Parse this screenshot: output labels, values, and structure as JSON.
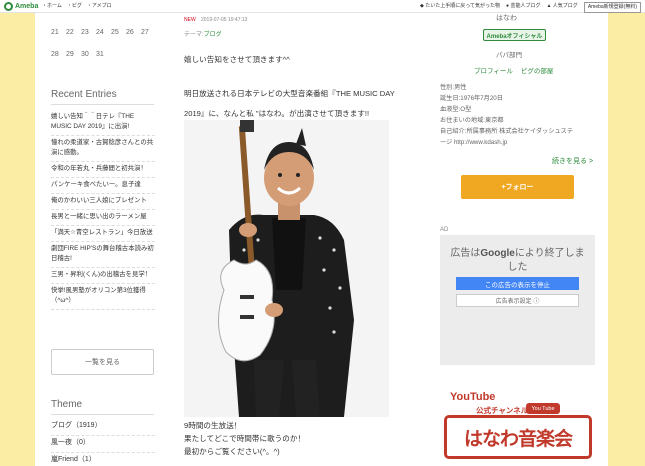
{
  "topbar": {
    "logo_text": "Ameba",
    "nav": [
      "・ホーム",
      "・ピグ",
      "・アメブロ"
    ],
    "notice": "たいた上手順に戻って気がった物",
    "links": [
      "芸能人ブログ",
      "人気ブログ"
    ],
    "register": "Ameba新規登録(無料)"
  },
  "calendar": {
    "rows": [
      [
        "21",
        "22",
        "23",
        "24",
        "25",
        "26",
        "27"
      ],
      [
        "28",
        "29",
        "30",
        "31"
      ]
    ]
  },
  "sidebar": {
    "recent_title": "Recent Entries",
    "entries": [
      "嬉しい告知＾＾日テレ『THE MUSIC DAY 2019』に出演!",
      "憧れの柔道家・古賀稔彦さんとの共演に感動。",
      "令和の年若丸・兵藤間と初共演！",
      "パンケーキ食べたいー。息子達",
      "俺のかわいい三人娘にプレゼント",
      "長男と一緒に思い出のラーメン屋",
      "「満天☆青空レストラン」今日放送",
      "劇団FIRE HIP'Sの舞台稽古本読み初日稽古!",
      "三男・昇利(くん)の出稽古を見学！",
      "快挙!風男塾がオリコン第3位獲得（^ω^）"
    ],
    "more_label": "一覧を見る",
    "theme_title": "Theme",
    "themes": [
      "ブログ（1919）",
      "風一夜（0）",
      "嵐Friend（1）"
    ]
  },
  "post": {
    "new_label": "NEW",
    "date": "2019-07-05 19:47:13",
    "theme_prefix": "テーマ:",
    "theme": "ブログ",
    "lines_top": [
      "嬉しい告知をさせて頂きます^^",
      "明日放送される日本テレビの大型音楽番組『THE MUSIC DAY",
      "2019』に、なんと私  \"はなわ。が出演させて頂きます!!"
    ],
    "lines_bottom": [
      "9時間の生放送！",
      "果たしてどこで時間帯に歌うのか！",
      "最初からご覧ください(^。^)"
    ]
  },
  "profile": {
    "name": "はなわ",
    "official_badge": "Amebaオフィシャル",
    "sub": "パパ部門",
    "links": [
      "プロフィール",
      "ピグの部屋"
    ],
    "details": [
      "性別:男性",
      "誕生日:1976年7月20日",
      "血液型:O型",
      "お住まいの地域:東京都",
      "自己紹介:所属事務所 株式会社ケイダッシュステ",
      "ージ http://www.kdash.jp"
    ],
    "continue_label": "続きを見る >",
    "follow_label": "+フォロー"
  },
  "ad": {
    "tag": "AD",
    "message_pre": "広告は",
    "brand": "Google",
    "message_post": "により終了しま",
    "message_line2": "した",
    "stop_label": "この広告の表示を停止",
    "why_label": "広告表示設定 ⓘ"
  },
  "youtube": {
    "title": "YouTube",
    "sub": "公式チャンネル",
    "logo": "You Tube",
    "big": "はなわ音楽会"
  }
}
